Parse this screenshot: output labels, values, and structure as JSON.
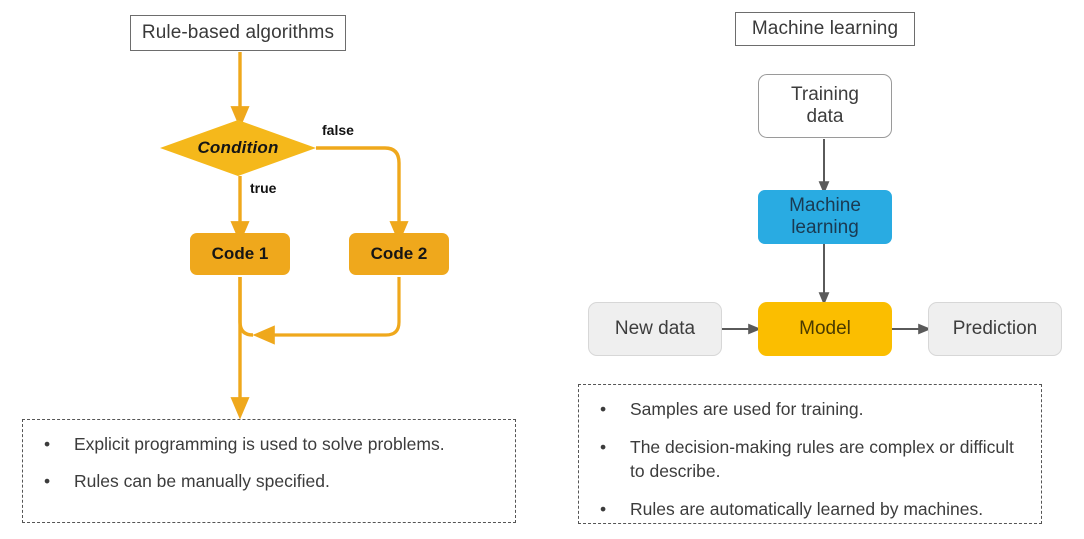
{
  "left_panel": {
    "title": "Rule-based algorithms",
    "nodes": {
      "condition": "Condition",
      "code1": "Code 1",
      "code2": "Code 2"
    },
    "edge_labels": {
      "true": "true",
      "false": "false"
    },
    "note": {
      "bullet": "•",
      "items": [
        "Explicit programming is used to solve problems.",
        "Rules can be manually specified."
      ]
    }
  },
  "right_panel": {
    "title": "Machine learning",
    "nodes": {
      "training_data": "Training\ndata",
      "training_data_line1": "Training",
      "training_data_line2": "data",
      "machine_learning_line1": "Machine",
      "machine_learning_line2": "learning",
      "new_data": "New data",
      "model": "Model",
      "prediction": "Prediction"
    },
    "note": {
      "bullet": "•",
      "items": [
        "Samples are used for training.",
        "The decision-making rules are complex or difficult to describe.",
        "Rules are automatically learned by machines."
      ]
    }
  },
  "colors": {
    "orange_flow": "#EFA81C",
    "amber_model": "#FBBE00",
    "blue_ml": "#29ABE2",
    "grey_box": "#EFEFEF",
    "arrow_grey": "#5a5a5a",
    "text_dark": "#3c3c3c",
    "dash_border": "#555555"
  }
}
